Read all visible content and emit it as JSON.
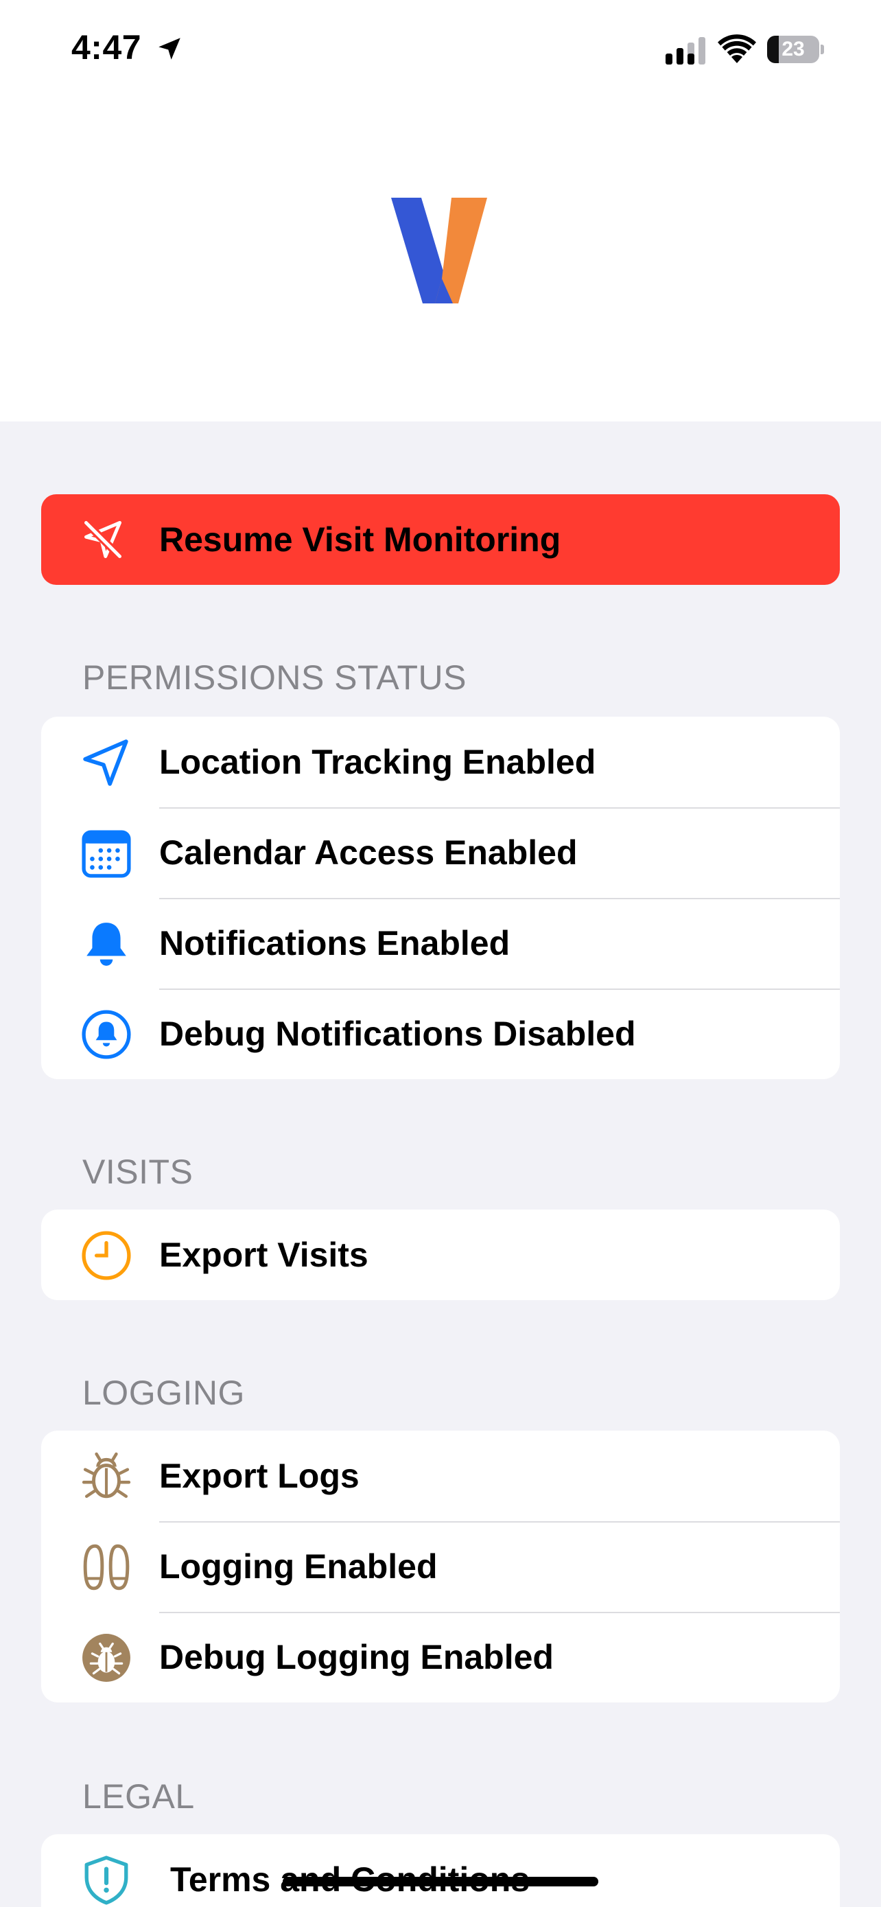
{
  "status_bar": {
    "time": "4:47",
    "battery_level": "23",
    "battery_fraction": 0.23
  },
  "colors": {
    "background": "#f2f2f7",
    "card": "#ffffff",
    "destructive": "#ff3b30",
    "blue": "#0a7aff",
    "orange": "#ff9f0a",
    "brown": "#a2845e",
    "teal": "#30b0c7",
    "logo_blue": "#3457d5",
    "logo_orange": "#f2893b"
  },
  "resume_button": {
    "label": "Resume Visit Monitoring",
    "icon": "location-slash-icon"
  },
  "sections": {
    "permissions": {
      "header": "PERMISSIONS STATUS",
      "items": [
        {
          "label": "Location Tracking Enabled",
          "icon": "location-arrow-icon"
        },
        {
          "label": "Calendar Access Enabled",
          "icon": "calendar-icon"
        },
        {
          "label": "Notifications Enabled",
          "icon": "bell-icon"
        },
        {
          "label": "Debug Notifications Disabled",
          "icon": "bell-circle-icon"
        }
      ]
    },
    "visits": {
      "header": "VISITS",
      "items": [
        {
          "label": "Export Visits",
          "icon": "clock-icon"
        }
      ]
    },
    "logging": {
      "header": "LOGGING",
      "items": [
        {
          "label": "Export Logs",
          "icon": "ladybug-icon"
        },
        {
          "label": "Logging Enabled",
          "icon": "footprints-icon"
        },
        {
          "label": "Debug Logging Enabled",
          "icon": "ladybug-circle-icon"
        }
      ]
    },
    "legal": {
      "header": "LEGAL",
      "items": [
        {
          "label": "Terms and Conditions",
          "icon": "shield-exclamation-icon"
        }
      ]
    }
  }
}
